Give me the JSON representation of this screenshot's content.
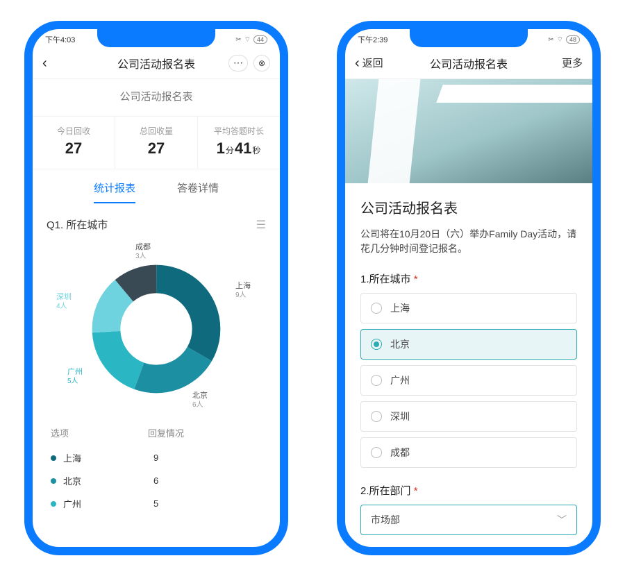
{
  "phone1": {
    "status": {
      "time": "下午4:03",
      "battery": "44"
    },
    "nav_title": "公司活动报名表",
    "subtitle": "公司活动报名表",
    "metrics": [
      {
        "label": "今日回收",
        "value": "27"
      },
      {
        "label": "总回收量",
        "value": "27"
      },
      {
        "label": "平均答题时长",
        "minutes": "1",
        "seconds": "41",
        "min_unit": "分",
        "sec_unit": "秒"
      }
    ],
    "tabs": {
      "stats": "统计报表",
      "detail": "答卷详情"
    },
    "question_title": "Q1. 所在城市",
    "donut_labels": {
      "chengdu": {
        "name": "成都",
        "count": "3人"
      },
      "shanghai": {
        "name": "上海",
        "count": "9人"
      },
      "beijing": {
        "name": "北京",
        "count": "6人"
      },
      "guangzhou": {
        "name": "广州",
        "count": "5人"
      },
      "shenzhen": {
        "name": "深圳",
        "count": "4人"
      }
    },
    "table": {
      "head_option": "选项",
      "head_reply": "回复情况",
      "rows": [
        {
          "name": "上海",
          "value": "9",
          "color": "#0f6a7d"
        },
        {
          "name": "北京",
          "value": "6",
          "color": "#1c8fa3"
        },
        {
          "name": "广州",
          "value": "5",
          "color": "#2bb6c4"
        }
      ]
    }
  },
  "phone2": {
    "status": {
      "time": "下午2:39",
      "battery": "48"
    },
    "back_label": "返回",
    "nav_title": "公司活动报名表",
    "more_label": "更多",
    "title": "公司活动报名表",
    "desc": "公司将在10月20日（六）举办Family Day活动，请花几分钟时间登记报名。",
    "q1_label": "1.所在城市",
    "q1_options": [
      "上海",
      "北京",
      "广州",
      "深圳",
      "成都"
    ],
    "q1_selected_index": 1,
    "q2_label": "2.所在部门",
    "q2_value": "市场部"
  },
  "chart_data": {
    "type": "pie",
    "title": "Q1. 所在城市",
    "categories": [
      "上海",
      "北京",
      "广州",
      "深圳",
      "成都"
    ],
    "values": [
      9,
      6,
      5,
      4,
      3
    ],
    "series_colors": [
      "#0f6a7d",
      "#1c8fa3",
      "#2bb6c4",
      "#6fd3df",
      "#3a4a55"
    ],
    "total": 27
  }
}
